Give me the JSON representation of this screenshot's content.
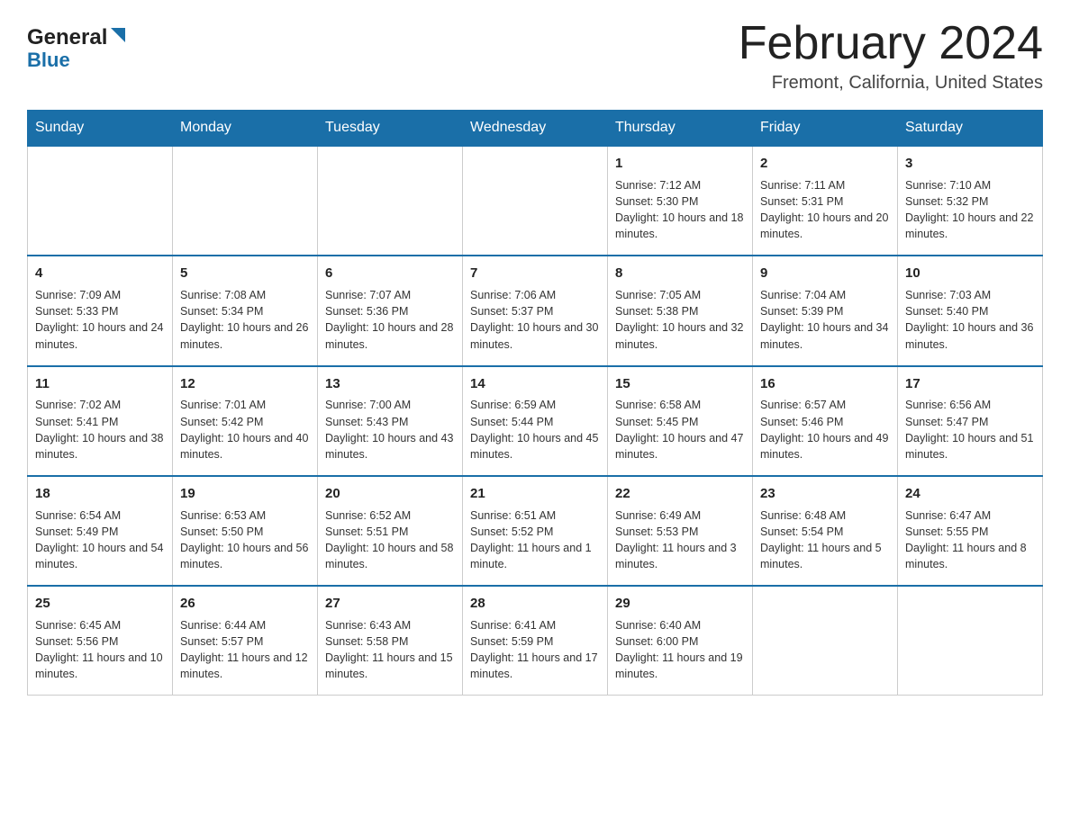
{
  "header": {
    "logo_general": "General",
    "logo_blue": "Blue",
    "title": "February 2024",
    "location": "Fremont, California, United States"
  },
  "days_of_week": [
    "Sunday",
    "Monday",
    "Tuesday",
    "Wednesday",
    "Thursday",
    "Friday",
    "Saturday"
  ],
  "weeks": [
    [
      {
        "day": "",
        "info": ""
      },
      {
        "day": "",
        "info": ""
      },
      {
        "day": "",
        "info": ""
      },
      {
        "day": "",
        "info": ""
      },
      {
        "day": "1",
        "info": "Sunrise: 7:12 AM\nSunset: 5:30 PM\nDaylight: 10 hours and 18 minutes."
      },
      {
        "day": "2",
        "info": "Sunrise: 7:11 AM\nSunset: 5:31 PM\nDaylight: 10 hours and 20 minutes."
      },
      {
        "day": "3",
        "info": "Sunrise: 7:10 AM\nSunset: 5:32 PM\nDaylight: 10 hours and 22 minutes."
      }
    ],
    [
      {
        "day": "4",
        "info": "Sunrise: 7:09 AM\nSunset: 5:33 PM\nDaylight: 10 hours and 24 minutes."
      },
      {
        "day": "5",
        "info": "Sunrise: 7:08 AM\nSunset: 5:34 PM\nDaylight: 10 hours and 26 minutes."
      },
      {
        "day": "6",
        "info": "Sunrise: 7:07 AM\nSunset: 5:36 PM\nDaylight: 10 hours and 28 minutes."
      },
      {
        "day": "7",
        "info": "Sunrise: 7:06 AM\nSunset: 5:37 PM\nDaylight: 10 hours and 30 minutes."
      },
      {
        "day": "8",
        "info": "Sunrise: 7:05 AM\nSunset: 5:38 PM\nDaylight: 10 hours and 32 minutes."
      },
      {
        "day": "9",
        "info": "Sunrise: 7:04 AM\nSunset: 5:39 PM\nDaylight: 10 hours and 34 minutes."
      },
      {
        "day": "10",
        "info": "Sunrise: 7:03 AM\nSunset: 5:40 PM\nDaylight: 10 hours and 36 minutes."
      }
    ],
    [
      {
        "day": "11",
        "info": "Sunrise: 7:02 AM\nSunset: 5:41 PM\nDaylight: 10 hours and 38 minutes."
      },
      {
        "day": "12",
        "info": "Sunrise: 7:01 AM\nSunset: 5:42 PM\nDaylight: 10 hours and 40 minutes."
      },
      {
        "day": "13",
        "info": "Sunrise: 7:00 AM\nSunset: 5:43 PM\nDaylight: 10 hours and 43 minutes."
      },
      {
        "day": "14",
        "info": "Sunrise: 6:59 AM\nSunset: 5:44 PM\nDaylight: 10 hours and 45 minutes."
      },
      {
        "day": "15",
        "info": "Sunrise: 6:58 AM\nSunset: 5:45 PM\nDaylight: 10 hours and 47 minutes."
      },
      {
        "day": "16",
        "info": "Sunrise: 6:57 AM\nSunset: 5:46 PM\nDaylight: 10 hours and 49 minutes."
      },
      {
        "day": "17",
        "info": "Sunrise: 6:56 AM\nSunset: 5:47 PM\nDaylight: 10 hours and 51 minutes."
      }
    ],
    [
      {
        "day": "18",
        "info": "Sunrise: 6:54 AM\nSunset: 5:49 PM\nDaylight: 10 hours and 54 minutes."
      },
      {
        "day": "19",
        "info": "Sunrise: 6:53 AM\nSunset: 5:50 PM\nDaylight: 10 hours and 56 minutes."
      },
      {
        "day": "20",
        "info": "Sunrise: 6:52 AM\nSunset: 5:51 PM\nDaylight: 10 hours and 58 minutes."
      },
      {
        "day": "21",
        "info": "Sunrise: 6:51 AM\nSunset: 5:52 PM\nDaylight: 11 hours and 1 minute."
      },
      {
        "day": "22",
        "info": "Sunrise: 6:49 AM\nSunset: 5:53 PM\nDaylight: 11 hours and 3 minutes."
      },
      {
        "day": "23",
        "info": "Sunrise: 6:48 AM\nSunset: 5:54 PM\nDaylight: 11 hours and 5 minutes."
      },
      {
        "day": "24",
        "info": "Sunrise: 6:47 AM\nSunset: 5:55 PM\nDaylight: 11 hours and 8 minutes."
      }
    ],
    [
      {
        "day": "25",
        "info": "Sunrise: 6:45 AM\nSunset: 5:56 PM\nDaylight: 11 hours and 10 minutes."
      },
      {
        "day": "26",
        "info": "Sunrise: 6:44 AM\nSunset: 5:57 PM\nDaylight: 11 hours and 12 minutes."
      },
      {
        "day": "27",
        "info": "Sunrise: 6:43 AM\nSunset: 5:58 PM\nDaylight: 11 hours and 15 minutes."
      },
      {
        "day": "28",
        "info": "Sunrise: 6:41 AM\nSunset: 5:59 PM\nDaylight: 11 hours and 17 minutes."
      },
      {
        "day": "29",
        "info": "Sunrise: 6:40 AM\nSunset: 6:00 PM\nDaylight: 11 hours and 19 minutes."
      },
      {
        "day": "",
        "info": ""
      },
      {
        "day": "",
        "info": ""
      }
    ]
  ]
}
